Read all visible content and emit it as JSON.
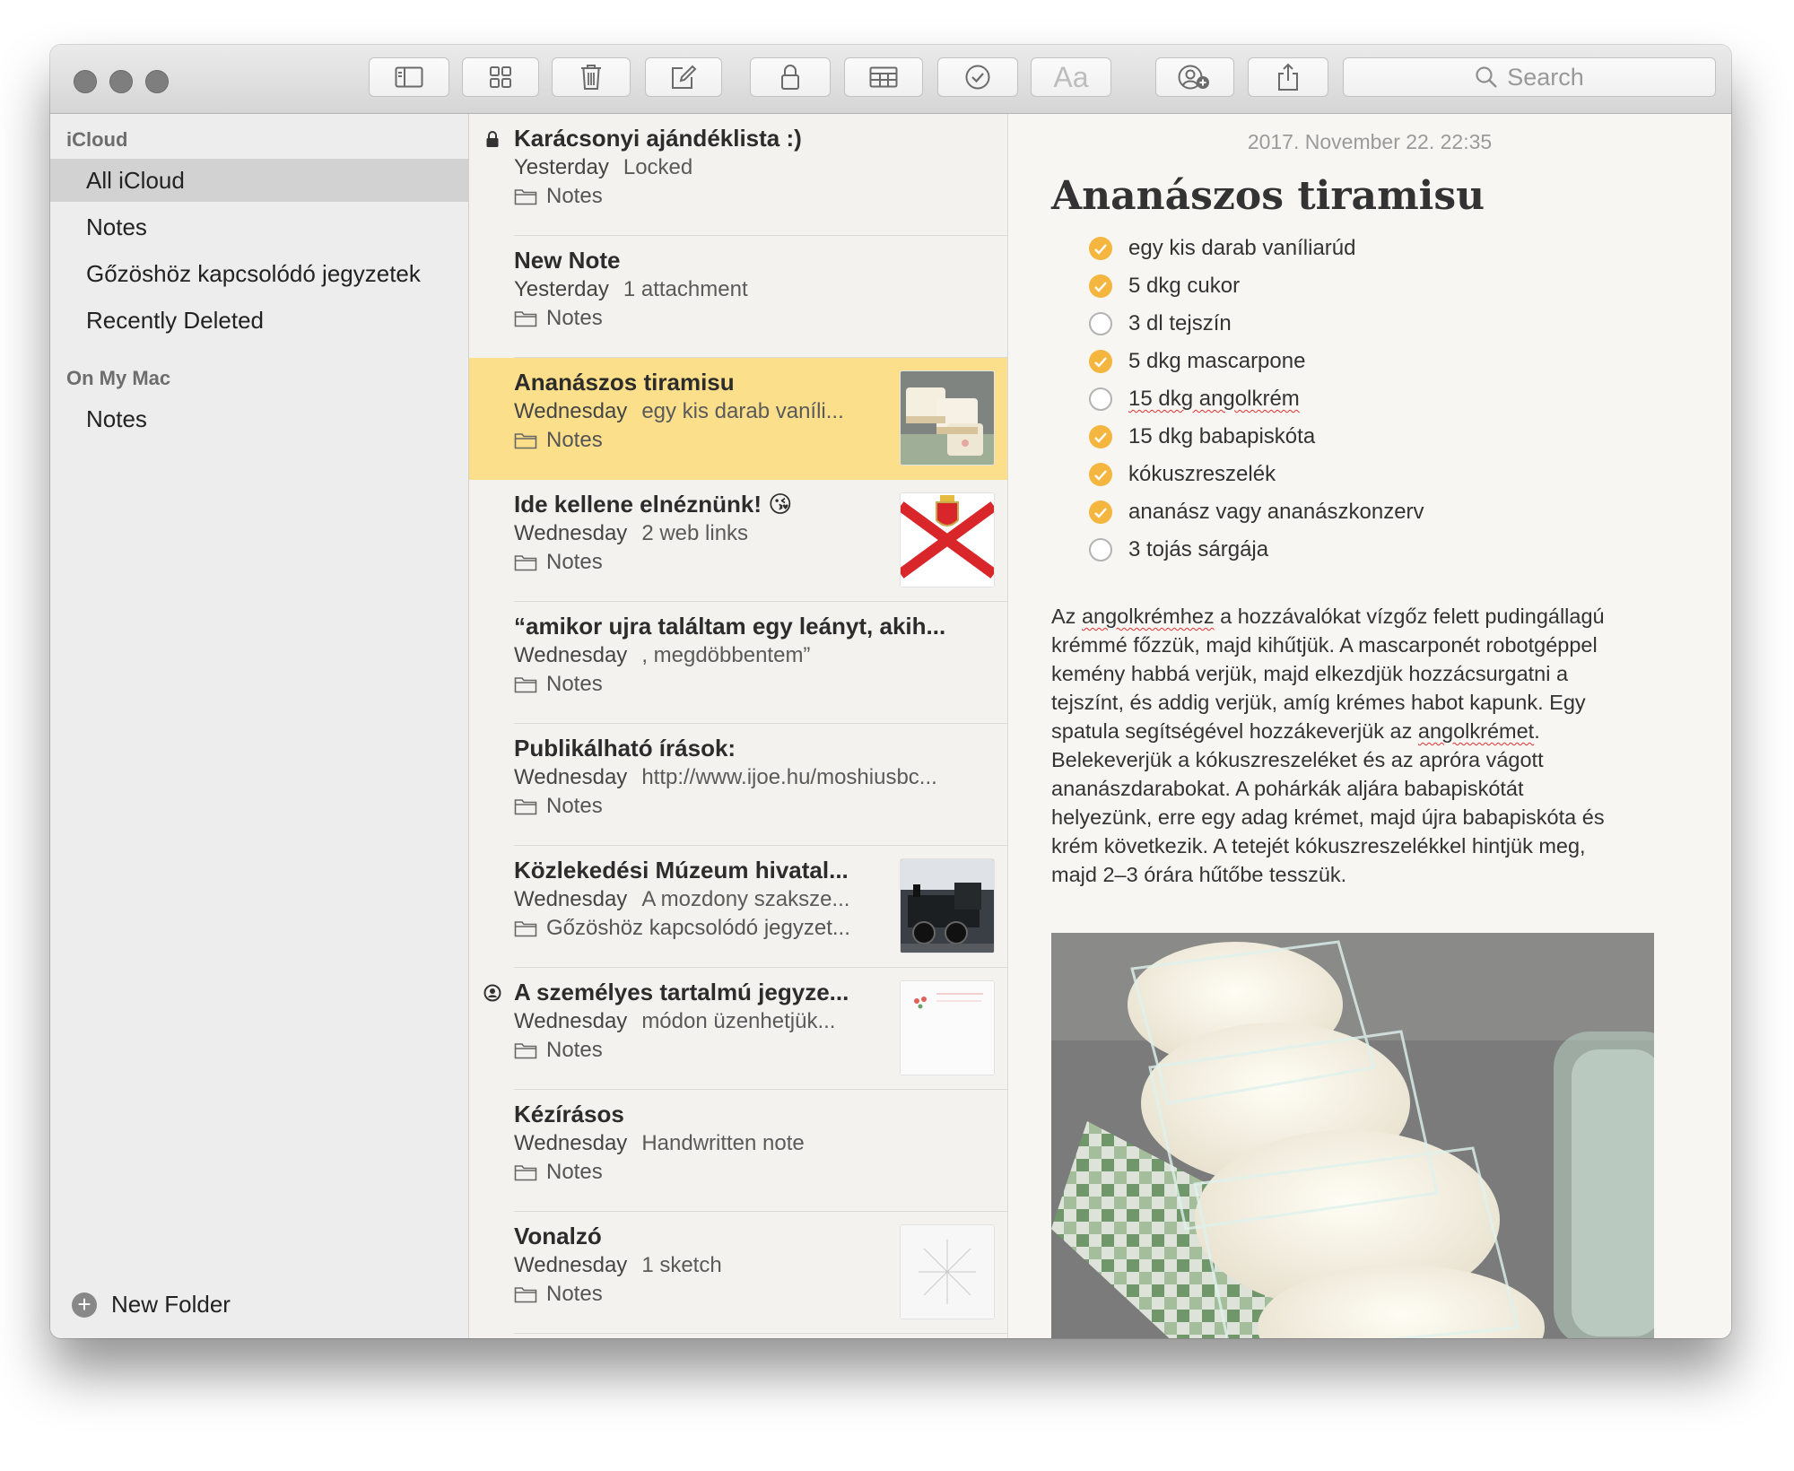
{
  "toolbar": {
    "buttons": [
      {
        "name": "sidebar-toggle-icon"
      },
      {
        "name": "attachments-browser-icon"
      },
      {
        "name": "trash-icon"
      },
      {
        "name": "compose-icon"
      },
      {
        "name": "lock-icon"
      },
      {
        "name": "table-icon"
      },
      {
        "name": "checklist-icon"
      },
      {
        "name": "format-text-icon"
      },
      {
        "name": "add-people-icon"
      },
      {
        "name": "share-icon"
      }
    ],
    "format_label": "Aa",
    "search_placeholder": "Search"
  },
  "sidebar": {
    "icloud_header": "iCloud",
    "icloud_items": [
      {
        "label": "All iCloud",
        "selected": true
      },
      {
        "label": "Notes"
      },
      {
        "label": "Gőzöshöz kapcsolódó jegyzetek"
      },
      {
        "label": "Recently Deleted"
      }
    ],
    "mac_header": "On My Mac",
    "mac_items": [
      {
        "label": "Notes"
      }
    ],
    "new_folder_label": "New Folder"
  },
  "notes": [
    {
      "title": "Karácsonyi ajándéklista :)",
      "date": "Yesterday",
      "snippet": "Locked",
      "folder": "Notes",
      "locked": true
    },
    {
      "title": "New Note",
      "date": "Yesterday",
      "snippet": "1 attachment",
      "folder": "Notes"
    },
    {
      "title": "Ananászos tiramisu",
      "date": "Wednesday",
      "snippet": "egy kis darab vaníli...",
      "folder": "Notes",
      "selected": true,
      "thumb": "dessert-photo"
    },
    {
      "title": "Ide kellene elnéznünk! 😘",
      "date": "Wednesday",
      "snippet": "2 web links",
      "folder": "Notes",
      "thumb": "flag-image"
    },
    {
      "title": "“amikor ujra találtam egy leányt, akih...",
      "date": "Wednesday",
      "snippet": ", megdöbbentem”",
      "folder": "Notes"
    },
    {
      "title": "Publikálható írások:",
      "date": "Wednesday",
      "snippet": "http://www.ijoe.hu/moshiusbc...",
      "folder": "Notes"
    },
    {
      "title": "Közlekedési Múzeum hivatal...",
      "date": "Wednesday",
      "snippet": "A mozdony szaksze...",
      "folder": "Gőzöshöz kapcsolódó jegyzet...",
      "thumb": "locomotive-photo"
    },
    {
      "title": "A személyes tartalmú jegyze...",
      "date": "Wednesday",
      "snippet": "módon üzenhetjük...",
      "folder": "Notes",
      "shared": true,
      "thumb": "card-image"
    },
    {
      "title": "Kézírásos",
      "date": "Wednesday",
      "snippet": "Handwritten note",
      "folder": "Notes"
    },
    {
      "title": "Vonalzó",
      "date": "Wednesday",
      "snippet": "1 sketch",
      "folder": "Notes",
      "thumb": "sketch-image"
    }
  ],
  "editor": {
    "date": "2017. November 22. 22:35",
    "title": "Ananászos tiramisu",
    "checklist": [
      {
        "text": "egy kis darab vaníliarúd",
        "checked": true
      },
      {
        "text": "5 dkg cukor",
        "checked": true
      },
      {
        "text": "3 dl tejszín",
        "checked": false
      },
      {
        "text": "5 dkg mascarpone",
        "checked": true
      },
      {
        "text": "15 dkg angolkrém",
        "checked": false
      },
      {
        "text": "15 dkg babapiskóta",
        "checked": true
      },
      {
        "text": "kókuszreszelék",
        "checked": true
      },
      {
        "text": "ananász vagy ananászkonzerv",
        "checked": true
      },
      {
        "text": "3 tojás sárgája",
        "checked": false
      }
    ],
    "paragraph_lines": [
      "Az angolkrémhez a hozzávalókat vízgőz felett pudingállagú",
      "krémmé főzzük, majd kihűtjük. A mascarponét robotgéppel",
      "kemény habbá verjük, majd elkezdjük hozzácsurgatni a",
      "tejszínt, és addig verjük, amíg krémes habot kapunk. Egy",
      "spatula segítségével hozzákeverjük az angolkrémet.",
      "Belekeverjük a kókuszreszeléket és az apróra vágott",
      "ananászdarabokat. A pohárkák aljára babapiskótát",
      "helyezünk, erre egy adag krémet, majd újra babapiskóta és",
      "krém következik. A tetejét kókuszreszelékkel hintjük meg,",
      "majd 2–3 órára hűtőbe tesszük."
    ],
    "spellcheck_words": [
      "angolkrémhez",
      "angolkrémet",
      "angolkrém"
    ],
    "photo": "dessert-photo",
    "accent_color": "#f4b63f"
  },
  "colors": {
    "selected_note_bg": "#fbdf8b",
    "sidebar_selected_bg": "#d2d2d2"
  }
}
